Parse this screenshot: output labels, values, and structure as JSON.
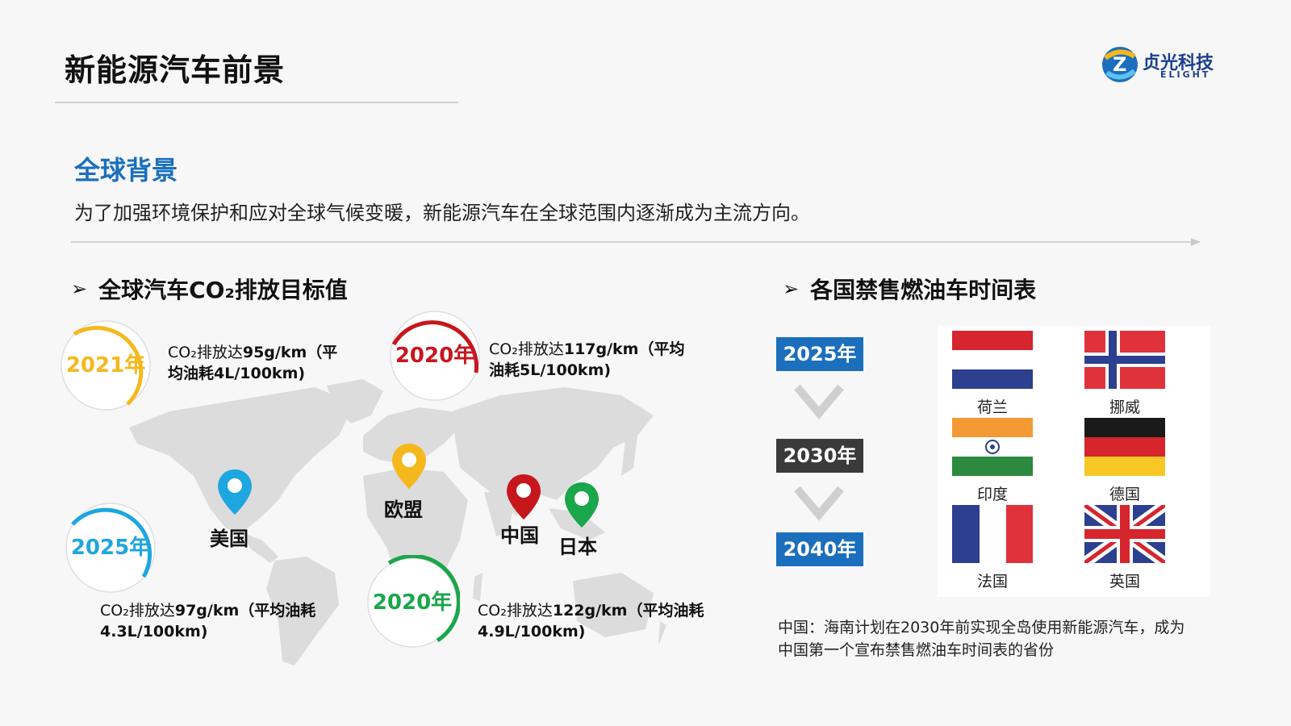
{
  "header": {
    "title": "新能源汽车前景",
    "logo_text": "贞光科技",
    "logo_subtext": "ELIGHT"
  },
  "intro": {
    "heading": "全球背景",
    "text": "为了加强环境保护和应对全球气候变暖，新能源汽车在全球范围内逐渐成为主流方向。"
  },
  "left_section": {
    "heading": "全球汽车CO₂排放目标值",
    "targets": [
      {
        "year": "2021年",
        "color": "#f5b81c",
        "line1_pre": "CO₂排放达",
        "line1_bold": "95g/km（平",
        "line2": "均油耗4L/100km)"
      },
      {
        "year": "2020年",
        "color": "#c8161d",
        "line1_pre": "CO₂排放达",
        "line1_bold": "117g/km（平均",
        "line2": "油耗5L/100km)"
      },
      {
        "year": "2025年",
        "color": "#1ea6e0",
        "line1_pre": "CO₂排放达",
        "line1_bold": "97g/km（平均油耗",
        "line2": "4.3L/100km)"
      },
      {
        "year": "2020年",
        "color": "#1aa64a",
        "line1_pre": "CO₂排放达",
        "line1_bold": "122g/km（平均油耗",
        "line2": "4.9L/100km)"
      }
    ],
    "pins": [
      {
        "label": "美国",
        "color": "#1ea6e0"
      },
      {
        "label": "欧盟",
        "color": "#f5b81c"
      },
      {
        "label": "中国",
        "color": "#c8161d"
      },
      {
        "label": "日本",
        "color": "#1aa64a"
      }
    ]
  },
  "right_section": {
    "heading": "各国禁售燃油车时间表",
    "years": [
      {
        "label": "2025年",
        "color": "#1b6fbd"
      },
      {
        "label": "2030年",
        "color": "#3a3a3a"
      },
      {
        "label": "2040年",
        "color": "#1b6fbd"
      }
    ],
    "countries": [
      "荷兰",
      "挪威",
      "印度",
      "德国",
      "法国",
      "英国"
    ],
    "note_line1": "中国：海南计划在2030年前实现全岛使用新能源汽车，成为",
    "note_line2": "中国第一个宣布禁售燃油车时间表的省份"
  },
  "colors": {
    "accent_blue": "#1b6fbd",
    "red": "#c8161d",
    "yellow": "#f5b81c",
    "cyan": "#1ea6e0",
    "green": "#1aa64a"
  }
}
